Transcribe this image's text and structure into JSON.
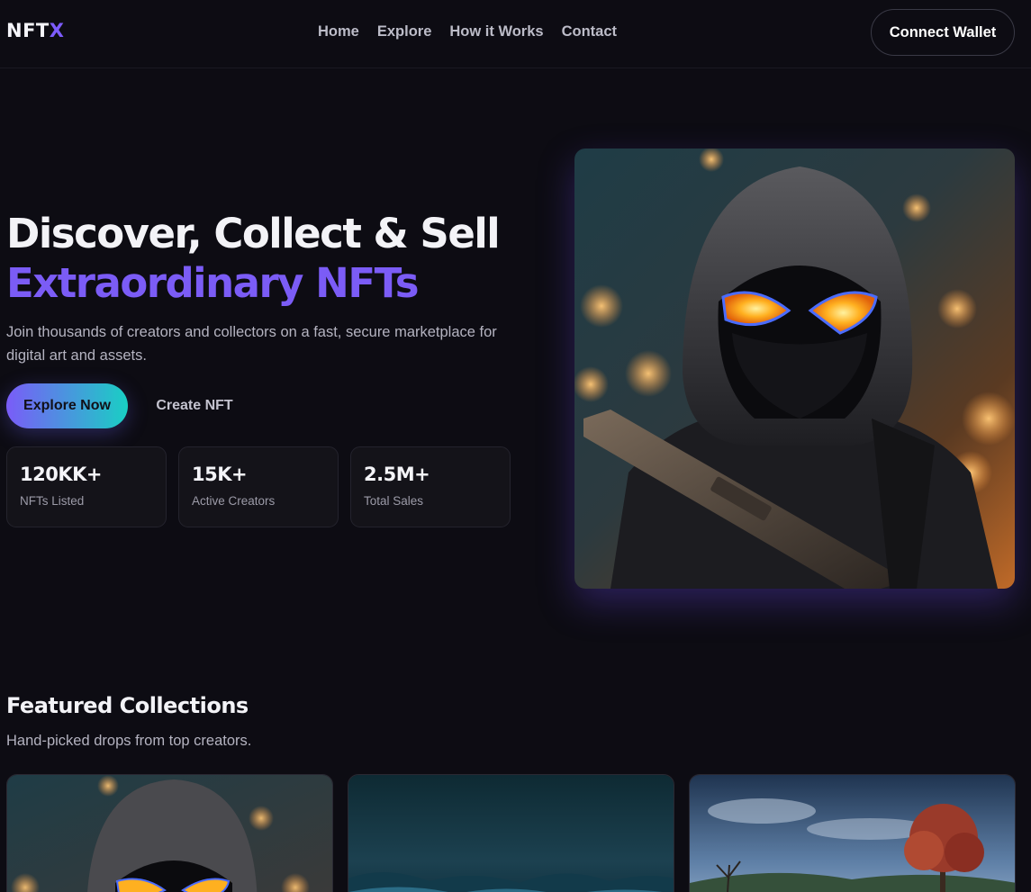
{
  "brand": {
    "name": "NFT",
    "accent_letter": "X"
  },
  "nav": {
    "items": [
      "Home",
      "Explore",
      "How it Works",
      "Contact"
    ]
  },
  "header": {
    "connect_label": "Connect Wallet"
  },
  "hero": {
    "title_line1": "Discover, Collect & Sell",
    "title_line2": "Extraordinary NFTs",
    "subtitle": "Join thousands of creators and collectors on a fast, secure marketplace for digital art and assets.",
    "primary_cta": "Explore Now",
    "secondary_cta": "Create NFT",
    "stats": [
      {
        "value": "120KK+",
        "label": "NFTs Listed"
      },
      {
        "value": "15K+",
        "label": "Active Creators"
      },
      {
        "value": "2.5M+",
        "label": "Total Sales"
      }
    ]
  },
  "featured": {
    "title": "Featured Collections",
    "subtitle": "Hand-picked drops from top creators."
  },
  "colors": {
    "background": "#0d0c13",
    "accent_purple": "#7b5cf6",
    "accent_teal": "#19cfc4",
    "card_border": "#24232d"
  }
}
